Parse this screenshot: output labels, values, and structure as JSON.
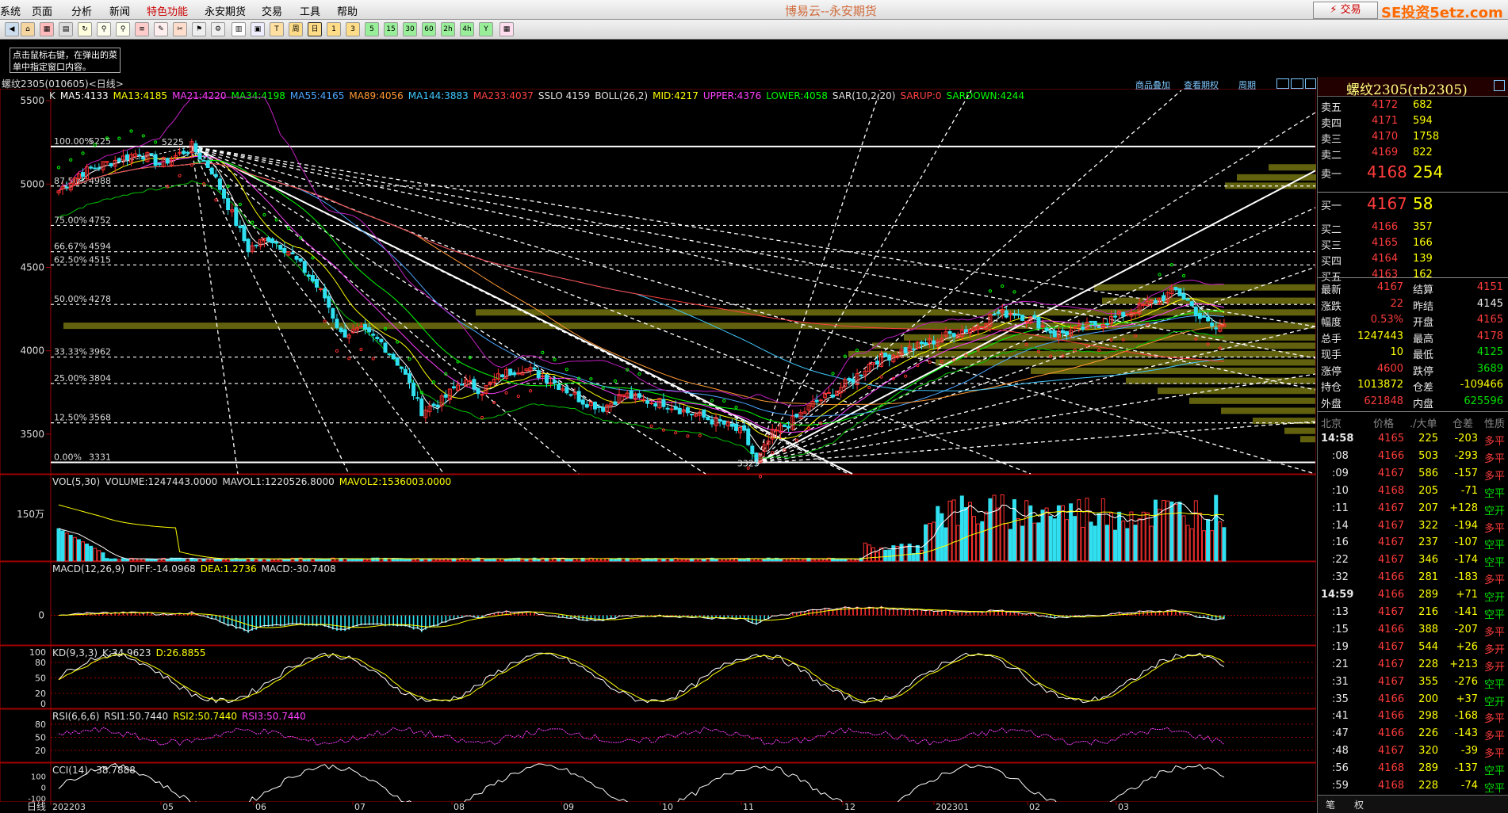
{
  "menu": [
    "系统",
    "页面",
    "分析",
    "新闻",
    "特色功能",
    "永安期货",
    "交易",
    "工具",
    "帮助"
  ],
  "app_title": "博易云--永安期货",
  "trade_label": "⚡ 交易",
  "logo": "SE投资5etz.com",
  "toolbar_labels": [
    "周",
    "日",
    "1",
    "3",
    "5",
    "15",
    "30",
    "60",
    "2h",
    "4h",
    "Y"
  ],
  "hint": "点击鼠标右键，在弹出的菜单中指定窗口内容。",
  "instrument_line": "螺纹2305(010605)<日线>",
  "header_links": {
    "link1": "商品叠加",
    "link2": "查看期权",
    "link3": "周期"
  },
  "ma_line": [
    {
      "t": "K",
      "c": "#e0e0e0"
    },
    {
      "t": "MA5:4133",
      "c": "#ffffff"
    },
    {
      "t": "MA13:4185",
      "c": "#ffff00"
    },
    {
      "t": "MA21:4220",
      "c": "#ff40ff"
    },
    {
      "t": "MA34:4198",
      "c": "#00ff00"
    },
    {
      "t": "MA55:4165",
      "c": "#4da6ff"
    },
    {
      "t": "MA89:4056",
      "c": "#ff9933"
    },
    {
      "t": "MA144:3883",
      "c": "#40c8ff"
    },
    {
      "t": "MA233:4037",
      "c": "#ff4040"
    },
    {
      "t": "SSLO 4159",
      "c": "#e0e0e0"
    },
    {
      "t": "BOLL(26,2)",
      "c": "#e0e0e0"
    },
    {
      "t": "MID:4217",
      "c": "#ffff00"
    },
    {
      "t": "UPPER:4376",
      "c": "#ff40ff"
    },
    {
      "t": "LOWER:4058",
      "c": "#00ff00"
    },
    {
      "t": "SAR(10,2,20)",
      "c": "#e0e0e0"
    },
    {
      "t": "SARUP:0",
      "c": "#ff4040"
    },
    {
      "t": "SARDOWN:4244",
      "c": "#00ff00"
    }
  ],
  "fib_levels": [
    {
      "label": "100.00%",
      "value": "5225"
    },
    {
      "label": "87.50%",
      "value": "4988"
    },
    {
      "label": "75.00%",
      "value": "4752"
    },
    {
      "label": "66.67%",
      "value": "4594"
    },
    {
      "label": "62.50%",
      "value": "4515"
    },
    {
      "label": "50.00%",
      "value": "4278"
    },
    {
      "label": "33.33%",
      "value": "3962"
    },
    {
      "label": "25.00%",
      "value": "3804"
    },
    {
      "label": "12.50%",
      "value": "3568"
    },
    {
      "label": "0.00%",
      "value": "3331"
    }
  ],
  "peak_label": "5225",
  "trough_label": "3325",
  "chart_data": {
    "type": "candlestick",
    "symbol": "螺纹2305",
    "period": "日线",
    "price_axis_ticks": [
      5500,
      5000,
      4500,
      4000,
      3500
    ],
    "x_tick_labels": [
      "202203",
      "05",
      "06",
      "07",
      "08",
      "09",
      "10",
      "11",
      "12",
      "202301",
      "02",
      "03"
    ],
    "close_path": [
      [
        0,
        4960
      ],
      [
        5,
        5060
      ],
      [
        10,
        5110
      ],
      [
        15,
        5150
      ],
      [
        20,
        5190
      ],
      [
        25,
        5120
      ],
      [
        30,
        5180
      ],
      [
        33,
        5225
      ],
      [
        38,
        5080
      ],
      [
        43,
        4820
      ],
      [
        47,
        4610
      ],
      [
        52,
        4680
      ],
      [
        57,
        4600
      ],
      [
        62,
        4450
      ],
      [
        66,
        4320
      ],
      [
        70,
        4100
      ],
      [
        75,
        4120
      ],
      [
        80,
        4050
      ],
      [
        85,
        3900
      ],
      [
        90,
        3640
      ],
      [
        95,
        3700
      ],
      [
        100,
        3820
      ],
      [
        105,
        3760
      ],
      [
        110,
        3860
      ],
      [
        115,
        3900
      ],
      [
        120,
        3850
      ],
      [
        125,
        3780
      ],
      [
        130,
        3700
      ],
      [
        135,
        3660
      ],
      [
        140,
        3740
      ],
      [
        145,
        3700
      ],
      [
        150,
        3690
      ],
      [
        155,
        3640
      ],
      [
        160,
        3600
      ],
      [
        165,
        3560
      ],
      [
        170,
        3500
      ],
      [
        173,
        3325
      ],
      [
        177,
        3500
      ],
      [
        182,
        3580
      ],
      [
        187,
        3680
      ],
      [
        192,
        3750
      ],
      [
        197,
        3830
      ],
      [
        202,
        3940
      ],
      [
        207,
        3980
      ],
      [
        212,
        4020
      ],
      [
        217,
        4060
      ],
      [
        222,
        4110
      ],
      [
        227,
        4140
      ],
      [
        232,
        4220
      ],
      [
        237,
        4230
      ],
      [
        242,
        4180
      ],
      [
        247,
        4100
      ],
      [
        252,
        4120
      ],
      [
        257,
        4160
      ],
      [
        262,
        4200
      ],
      [
        267,
        4250
      ],
      [
        272,
        4300
      ],
      [
        277,
        4360
      ],
      [
        280,
        4300
      ],
      [
        283,
        4200
      ],
      [
        287,
        4130
      ],
      [
        289,
        4167
      ]
    ],
    "volume_label": "VOL(5,30)",
    "volume": {
      "VOLUME": "1247443.0000",
      "MAVOL1": "1220526.8000",
      "MAVOL2": "1536003.0000"
    },
    "volume_tick": "150万",
    "macd": {
      "label": "MACD(12,26,9)",
      "DIFF": "-14.0968",
      "DEA": "1.2736",
      "MACD": "-30.7408",
      "ticks": [
        "0"
      ]
    },
    "kd": {
      "label": "KD(9,3,3)",
      "K": "34.9623",
      "D": "26.8855",
      "ticks": [
        "100",
        "80",
        "50",
        "20",
        "0"
      ]
    },
    "rsi": {
      "label": "RSI(6,6,6)",
      "RSI1": "50.7440",
      "RSI2": "50.7440",
      "RSI3": "50.7440",
      "ticks": [
        "80",
        "50",
        "20"
      ]
    },
    "cci": {
      "label": "CCI(14)",
      "value": "-38.7888",
      "ticks": [
        "100",
        "0",
        "-100"
      ]
    },
    "x_axis_corner": "日线"
  },
  "quote_title": "螺纹2305(rb2305)",
  "asks": [
    {
      "label": "卖五",
      "price": "4172",
      "vol": "682"
    },
    {
      "label": "卖四",
      "price": "4171",
      "vol": "594"
    },
    {
      "label": "卖三",
      "price": "4170",
      "vol": "1758"
    },
    {
      "label": "卖二",
      "price": "4169",
      "vol": "822"
    },
    {
      "label": "卖一",
      "price": "4168",
      "vol": "254"
    }
  ],
  "bids": [
    {
      "label": "买一",
      "price": "4167",
      "vol": "58"
    },
    {
      "label": "买二",
      "price": "4166",
      "vol": "357"
    },
    {
      "label": "买三",
      "price": "4165",
      "vol": "166"
    },
    {
      "label": "买四",
      "price": "4164",
      "vol": "139"
    },
    {
      "label": "买五",
      "price": "4163",
      "vol": "162"
    }
  ],
  "stats": [
    {
      "l1": "最新",
      "v1": "4167",
      "c1": "red",
      "l2": "结算",
      "v2": "4151",
      "c2": "red"
    },
    {
      "l1": "涨跌",
      "v1": "22",
      "c1": "red",
      "l2": "昨结",
      "v2": "4145",
      "c2": "wht"
    },
    {
      "l1": "幅度",
      "v1": "0.53%",
      "c1": "red",
      "l2": "开盘",
      "v2": "4165",
      "c2": "red"
    },
    {
      "l1": "总手",
      "v1": "1247443",
      "c1": "yel",
      "l2": "最高",
      "v2": "4178",
      "c2": "red"
    },
    {
      "l1": "现手",
      "v1": "10",
      "c1": "yel",
      "l2": "最低",
      "v2": "4125",
      "c2": "grn"
    },
    {
      "l1": "涨停",
      "v1": "4600",
      "c1": "red",
      "l2": "跌停",
      "v2": "3689",
      "c2": "grn"
    },
    {
      "l1": "持仓",
      "v1": "1013872",
      "c1": "yel",
      "l2": "仓差",
      "v2": "-109466",
      "c2": "yel"
    },
    {
      "l1": "外盘",
      "v1": "621848",
      "c1": "red",
      "l2": "内盘",
      "v2": "625596",
      "c2": "grn"
    }
  ],
  "tick_header": {
    "h1": "北京",
    "h2": "价格",
    "h3": "./大单",
    "h4": "仓差",
    "h5": "性质"
  },
  "ticks": [
    {
      "time": "14:58",
      "price": "4165",
      "vol": "225",
      "diff": "-203",
      "kind": "多平",
      "kc": "red",
      "big": true
    },
    {
      "time": ":08",
      "price": "4166",
      "vol": "503",
      "diff": "-293",
      "kind": "多平",
      "kc": "red"
    },
    {
      "time": ":09",
      "price": "4167",
      "vol": "586",
      "diff": "-157",
      "kind": "多平",
      "kc": "red"
    },
    {
      "time": ":10",
      "price": "4168",
      "vol": "205",
      "diff": "-71",
      "kind": "空平",
      "kc": "grn"
    },
    {
      "time": ":11",
      "price": "4167",
      "vol": "207",
      "diff": "+128",
      "kind": "空开",
      "kc": "grn"
    },
    {
      "time": ":14",
      "price": "4167",
      "vol": "322",
      "diff": "-194",
      "kind": "多平",
      "kc": "red"
    },
    {
      "time": ":16",
      "price": "4167",
      "vol": "237",
      "diff": "-107",
      "kind": "空平",
      "kc": "grn"
    },
    {
      "time": ":22",
      "price": "4167",
      "vol": "346",
      "diff": "-174",
      "kind": "空平",
      "kc": "grn"
    },
    {
      "time": ":32",
      "price": "4166",
      "vol": "281",
      "diff": "-183",
      "kind": "多平",
      "kc": "red"
    },
    {
      "time": "14:59",
      "price": "4166",
      "vol": "289",
      "diff": "+71",
      "kind": "空开",
      "kc": "grn",
      "big": true
    },
    {
      "time": ":13",
      "price": "4167",
      "vol": "216",
      "diff": "-141",
      "kind": "空平",
      "kc": "grn"
    },
    {
      "time": ":15",
      "price": "4166",
      "vol": "388",
      "diff": "-207",
      "kind": "多平",
      "kc": "red"
    },
    {
      "time": ":19",
      "price": "4167",
      "vol": "544",
      "diff": "+26",
      "kind": "多开",
      "kc": "red"
    },
    {
      "time": ":21",
      "price": "4167",
      "vol": "228",
      "diff": "+213",
      "kind": "多开",
      "kc": "red"
    },
    {
      "time": ":31",
      "price": "4167",
      "vol": "355",
      "diff": "-276",
      "kind": "空平",
      "kc": "grn"
    },
    {
      "time": ":35",
      "price": "4166",
      "vol": "200",
      "diff": "+37",
      "kind": "空开",
      "kc": "grn"
    },
    {
      "time": ":41",
      "price": "4166",
      "vol": "298",
      "diff": "-168",
      "kind": "多平",
      "kc": "red"
    },
    {
      "time": ":47",
      "price": "4166",
      "vol": "226",
      "diff": "-143",
      "kind": "多平",
      "kc": "red"
    },
    {
      "time": ":48",
      "price": "4167",
      "vol": "320",
      "diff": "-39",
      "kind": "多平",
      "kc": "red"
    },
    {
      "time": ":56",
      "price": "4168",
      "vol": "289",
      "diff": "-137",
      "kind": "空平",
      "kc": "grn"
    },
    {
      "time": ":59",
      "price": "4168",
      "vol": "228",
      "diff": "-74",
      "kind": "空平",
      "kc": "grn"
    }
  ],
  "bottom_tabs": {
    "t1": "笔",
    "t2": "权"
  }
}
